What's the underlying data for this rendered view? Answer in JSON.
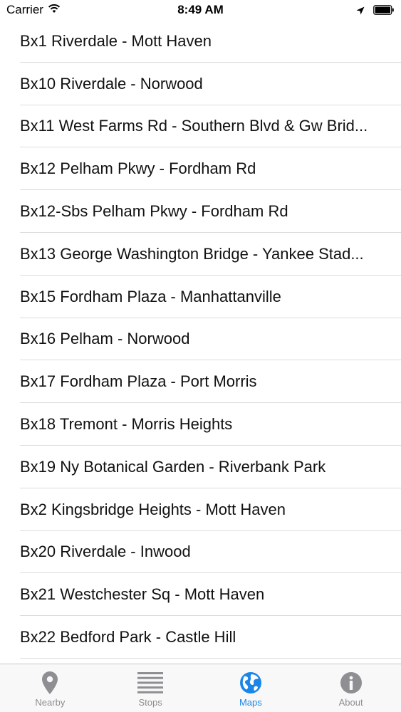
{
  "status_bar": {
    "carrier": "Carrier",
    "time": "8:49 AM",
    "icons": [
      "wifi-icon",
      "location-arrow-icon",
      "battery-icon"
    ]
  },
  "routes": [
    {
      "label": "Bx1 Riverdale - Mott Haven"
    },
    {
      "label": "Bx10 Riverdale - Norwood"
    },
    {
      "label": "Bx11 West Farms Rd - Southern Blvd & Gw Brid..."
    },
    {
      "label": "Bx12 Pelham Pkwy - Fordham Rd"
    },
    {
      "label": "Bx12-Sbs Pelham Pkwy - Fordham Rd"
    },
    {
      "label": "Bx13 George Washington Bridge - Yankee Stad..."
    },
    {
      "label": "Bx15 Fordham Plaza - Manhattanville"
    },
    {
      "label": "Bx16 Pelham - Norwood"
    },
    {
      "label": "Bx17 Fordham Plaza - Port Morris"
    },
    {
      "label": "Bx18 Tremont - Morris Heights"
    },
    {
      "label": "Bx19 Ny Botanical Garden - Riverbank Park"
    },
    {
      "label": "Bx2 Kingsbridge Heights - Mott Haven"
    },
    {
      "label": "Bx20 Riverdale - Inwood"
    },
    {
      "label": "Bx21 Westchester Sq - Mott Haven"
    },
    {
      "label": "Bx22 Bedford Park - Castle Hill"
    }
  ],
  "tab_bar": {
    "active_color": "#1a86e8",
    "inactive_color": "#8e8e93",
    "tabs": [
      {
        "label": "Nearby",
        "icon": "map-pin-icon",
        "active": false
      },
      {
        "label": "Stops",
        "icon": "list-lines-icon",
        "active": false
      },
      {
        "label": "Maps",
        "icon": "globe-icon",
        "active": true
      },
      {
        "label": "About",
        "icon": "info-icon",
        "active": false
      }
    ]
  }
}
